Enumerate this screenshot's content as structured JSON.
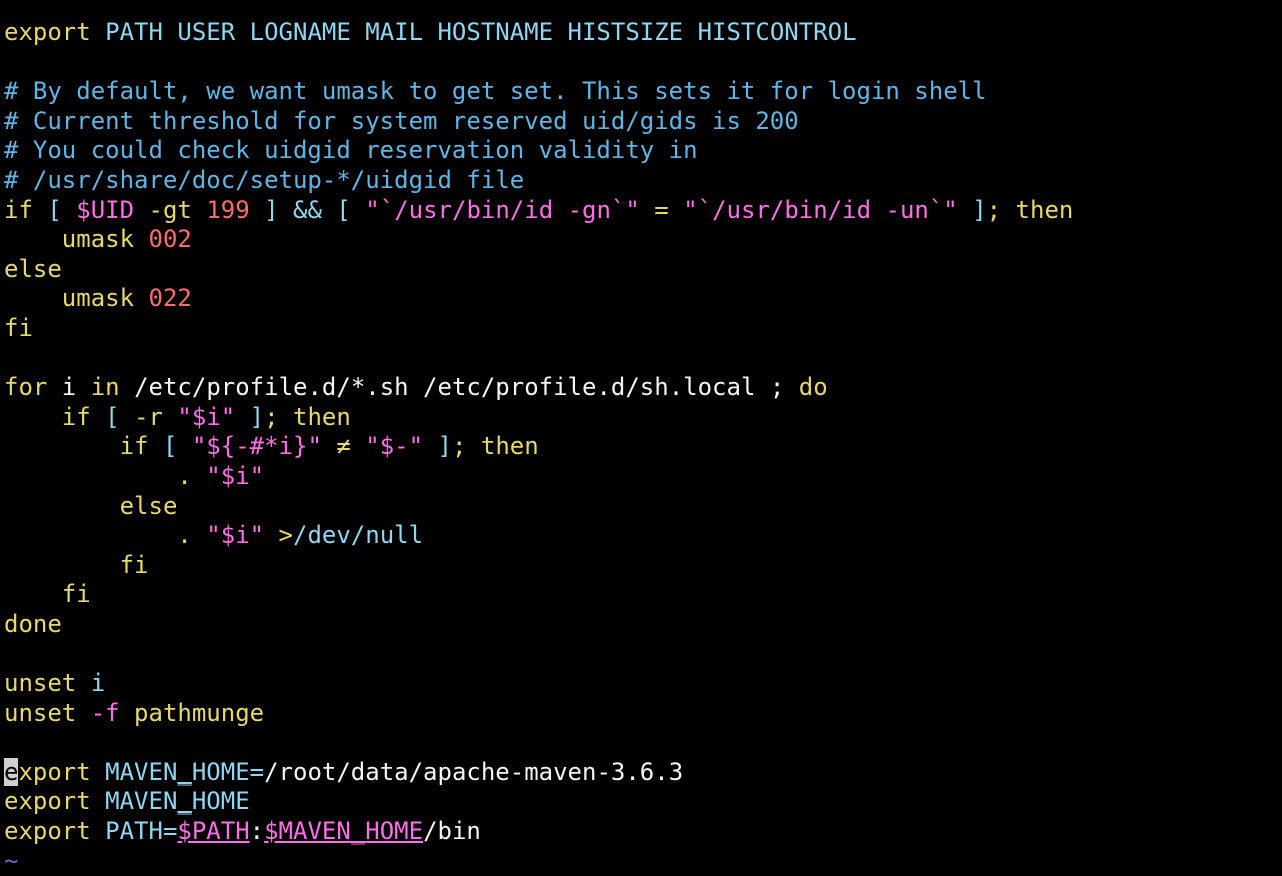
{
  "editor": {
    "background": "#000000",
    "colors": {
      "keyword": "#e8d86a",
      "variable": "#8fd6f2",
      "comment": "#5fb6e6",
      "number": "#ff6b6b",
      "special": "#ff6ee6",
      "text": "#f5f5f5",
      "tilde": "#5f6bd6"
    },
    "lines": [
      [
        {
          "t": "export",
          "c": "kw"
        },
        {
          "t": " PATH USER LOGNAME MAIL HOSTNAME HISTSIZE HISTCONTROL",
          "c": "var"
        }
      ],
      [],
      [
        {
          "t": "# By default, we want umask to get set. This sets it for login shell",
          "c": "comment"
        }
      ],
      [
        {
          "t": "# Current threshold for system reserved uid/gids is 200",
          "c": "comment"
        }
      ],
      [
        {
          "t": "# You could check uidgid reservation validity in",
          "c": "comment"
        }
      ],
      [
        {
          "t": "# /usr/share/doc/setup-*/uidgid file",
          "c": "comment"
        }
      ],
      [
        {
          "t": "if",
          "c": "kw"
        },
        {
          "t": " [ ",
          "c": "var"
        },
        {
          "t": "$UID",
          "c": "op"
        },
        {
          "t": " -gt ",
          "c": "kw"
        },
        {
          "t": "199",
          "c": "num"
        },
        {
          "t": " ] ",
          "c": "var"
        },
        {
          "t": "&&",
          "c": "var"
        },
        {
          "t": " [ ",
          "c": "var"
        },
        {
          "t": "\"`/usr/bin/id -gn`\"",
          "c": "str"
        },
        {
          "t": " = ",
          "c": "kw"
        },
        {
          "t": "\"`/usr/bin/id -un`\"",
          "c": "str"
        },
        {
          "t": " ]",
          "c": "var"
        },
        {
          "t": "; then",
          "c": "kw"
        }
      ],
      [
        {
          "t": "    umask ",
          "c": "kw"
        },
        {
          "t": "002",
          "c": "num"
        }
      ],
      [
        {
          "t": "else",
          "c": "kw"
        }
      ],
      [
        {
          "t": "    umask ",
          "c": "kw"
        },
        {
          "t": "022",
          "c": "num"
        }
      ],
      [
        {
          "t": "fi",
          "c": "kw"
        }
      ],
      [],
      [
        {
          "t": "for",
          "c": "kw"
        },
        {
          "t": " i ",
          "c": "text"
        },
        {
          "t": "in",
          "c": "kw"
        },
        {
          "t": " /etc/profile.d/*.sh /etc/profile.d/sh.local ",
          "c": "text"
        },
        {
          "t": "; ",
          "c": "text"
        },
        {
          "t": "do",
          "c": "kw"
        }
      ],
      [
        {
          "t": "    if",
          "c": "kw"
        },
        {
          "t": " [ ",
          "c": "var"
        },
        {
          "t": "-r ",
          "c": "kw"
        },
        {
          "t": "\"$i\"",
          "c": "str"
        },
        {
          "t": " ]",
          "c": "var"
        },
        {
          "t": "; then",
          "c": "kw"
        }
      ],
      [
        {
          "t": "        if",
          "c": "kw"
        },
        {
          "t": " [ ",
          "c": "var"
        },
        {
          "t": "\"${-#*i}\"",
          "c": "str"
        },
        {
          "t": " ≠ ",
          "c": "kw"
        },
        {
          "t": "\"$-\"",
          "c": "str"
        },
        {
          "t": " ]",
          "c": "var"
        },
        {
          "t": "; then",
          "c": "kw"
        }
      ],
      [
        {
          "t": "            . ",
          "c": "kw"
        },
        {
          "t": "\"$i\"",
          "c": "str"
        }
      ],
      [
        {
          "t": "        else",
          "c": "kw"
        }
      ],
      [
        {
          "t": "            . ",
          "c": "kw"
        },
        {
          "t": "\"$i\"",
          "c": "str"
        },
        {
          "t": " >",
          "c": "kw"
        },
        {
          "t": "/dev/null",
          "c": "var"
        }
      ],
      [
        {
          "t": "        fi",
          "c": "kw"
        }
      ],
      [
        {
          "t": "    fi",
          "c": "kw"
        }
      ],
      [
        {
          "t": "done",
          "c": "kw"
        }
      ],
      [],
      [
        {
          "t": "unset",
          "c": "kw"
        },
        {
          "t": " i",
          "c": "var"
        }
      ],
      [
        {
          "t": "unset",
          "c": "kw"
        },
        {
          "t": " -f ",
          "c": "op"
        },
        {
          "t": "pathmunge",
          "c": "kw"
        }
      ],
      [],
      [
        {
          "t": "e",
          "c": "cursor"
        },
        {
          "t": "xport",
          "c": "kw"
        },
        {
          "t": " MAVEN",
          "c": "var"
        },
        {
          "t": "_",
          "c": "var-under"
        },
        {
          "t": "HOME=",
          "c": "var"
        },
        {
          "t": "/root/data/apache-maven-3.6.3",
          "c": "text"
        }
      ],
      [
        {
          "t": "export",
          "c": "kw"
        },
        {
          "t": " MAVEN",
          "c": "var"
        },
        {
          "t": "_",
          "c": "var-under"
        },
        {
          "t": "HOME",
          "c": "var"
        }
      ],
      [
        {
          "t": "export",
          "c": "kw"
        },
        {
          "t": " PATH=",
          "c": "var"
        },
        {
          "t": "$PATH",
          "c": "op-under"
        },
        {
          "t": ":",
          "c": "text"
        },
        {
          "t": "$MAVEN",
          "c": "op-under"
        },
        {
          "t": "_",
          "c": "op-under"
        },
        {
          "t": "HOME",
          "c": "op-under"
        },
        {
          "t": "/bin",
          "c": "text"
        }
      ],
      [
        {
          "t": "~",
          "c": "tilde"
        }
      ]
    ]
  }
}
